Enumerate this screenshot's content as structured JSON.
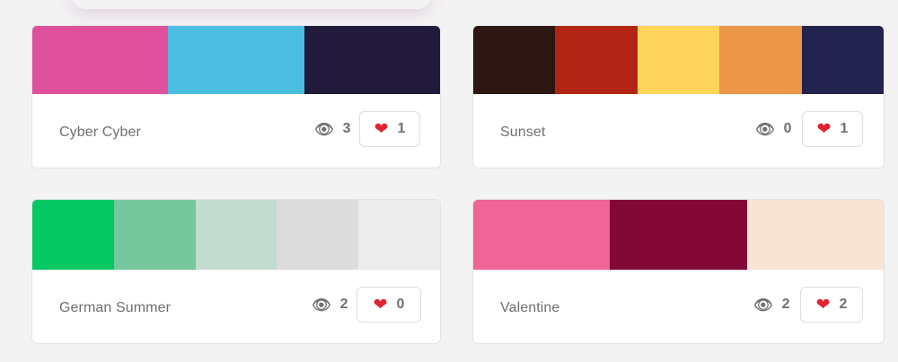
{
  "palettes": [
    {
      "name": "Cyber Cyber",
      "views": "3",
      "likes": "1",
      "colors": [
        "#de509b",
        "#4cbde0",
        "#221a3b"
      ]
    },
    {
      "name": "Sunset",
      "views": "0",
      "likes": "1",
      "colors": [
        "#2d1712",
        "#b22414",
        "#fed55a",
        "#ec9748",
        "#232350"
      ]
    },
    {
      "name": "German Summer",
      "views": "2",
      "likes": "0",
      "colors": [
        "#05c862",
        "#77c79e",
        "#c2dccf",
        "#dcdcdc",
        "#ececec"
      ]
    },
    {
      "name": "Valentine",
      "views": "2",
      "likes": "2",
      "colors": [
        "#ef6597",
        "#820836",
        "#f8e4d4"
      ]
    }
  ],
  "icons": {
    "views": "eye-icon",
    "likes": "heart-icon"
  }
}
